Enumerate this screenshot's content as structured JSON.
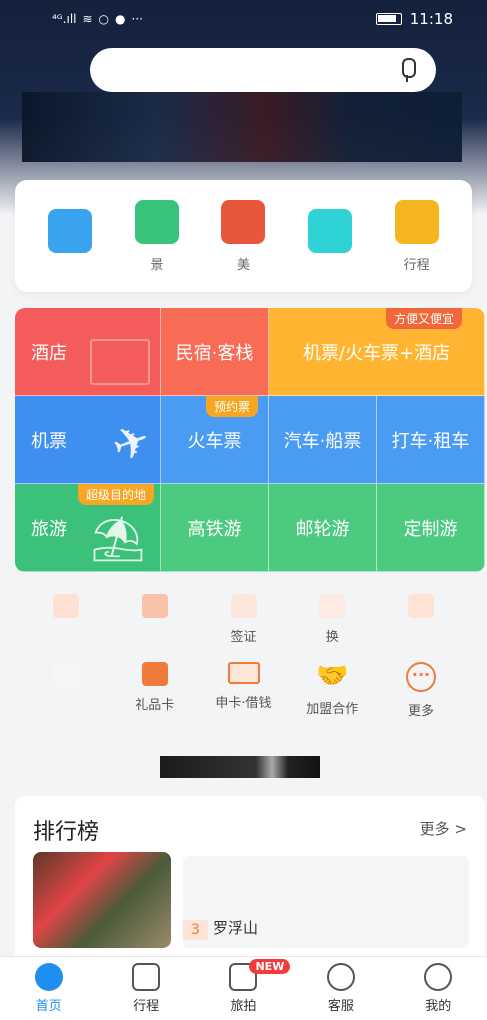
{
  "status": {
    "signal": "⁴ᴳ.ıll",
    "time": "11:18"
  },
  "quick": [
    {
      "label": "",
      "color": "#3aa3f0"
    },
    {
      "label": "景",
      "color": "#39c27a"
    },
    {
      "label": "美",
      "color": "#e8573b"
    },
    {
      "label": "",
      "color": "#2fd3d6"
    },
    {
      "label": "行程",
      "color": "#f4b51f"
    }
  ],
  "grid": {
    "hotel": "酒店",
    "homestay": "民宿·客栈",
    "flight_train_hotel": "机票/火车票+酒店",
    "flight_train_hotel_badge": "方便又便宜",
    "flight": "机票",
    "train": "火车票",
    "train_badge": "预约票",
    "bus_ship": "汽车·船票",
    "taxi_rent": "打车·租车",
    "travel": "旅游",
    "travel_badge": "超级目的地",
    "hsr_travel": "高铁游",
    "cruise": "邮轮游",
    "custom": "定制游",
    "colors": {
      "hotel": "#f45b5b",
      "flight_combo": "#ffb531",
      "flight": "#3f8ff0",
      "travel": "#3cc17a"
    }
  },
  "row_a": [
    {
      "label": ""
    },
    {
      "label": ""
    },
    {
      "label": "签证"
    },
    {
      "label": "换"
    },
    {
      "label": ""
    }
  ],
  "row_b": [
    {
      "label": ""
    },
    {
      "label": "礼品卡"
    },
    {
      "label": "申卡·借钱"
    },
    {
      "label": "加盟合作"
    },
    {
      "label": "更多"
    }
  ],
  "ranking": {
    "title": "排行榜",
    "more": "更多 >",
    "rank_num": "3",
    "place": "罗浮山"
  },
  "tabs": [
    {
      "label": "首页",
      "icon": "home-icon"
    },
    {
      "label": "行程",
      "icon": "calendar-icon"
    },
    {
      "label": "旅拍",
      "icon": "camera-icon",
      "badge": "NEW"
    },
    {
      "label": "客服",
      "icon": "headset-icon"
    },
    {
      "label": "我的",
      "icon": "user-icon"
    }
  ]
}
